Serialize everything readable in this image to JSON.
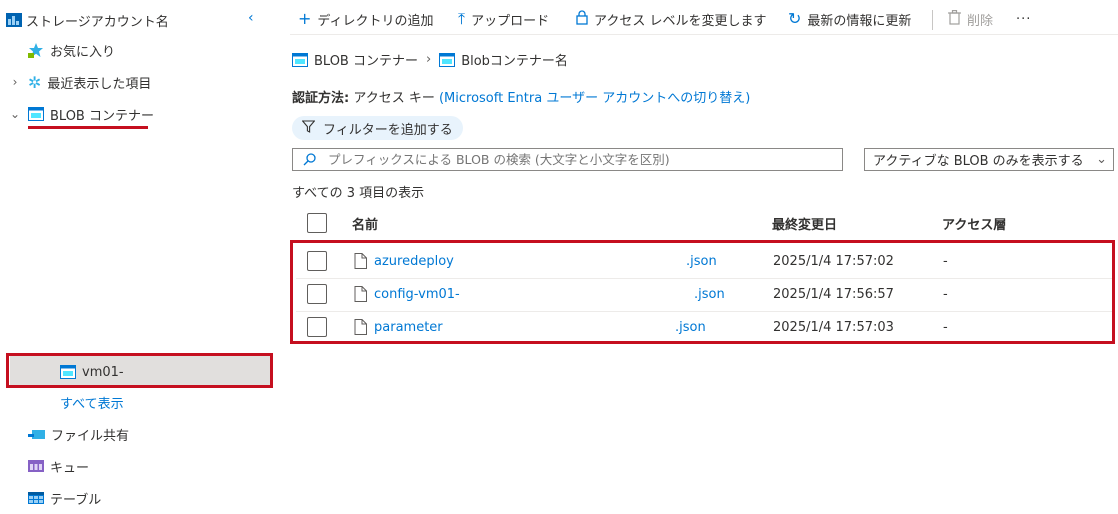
{
  "sidebar": {
    "account_name": "ストレージアカウント名",
    "favorites": "お気に入り",
    "recent": "最近表示した項目",
    "blob_containers": "BLOB コンテナー",
    "container_item": "vm01-",
    "show_all": "すべて表示",
    "file_shares": "ファイル共有",
    "queues": "キュー",
    "tables": "テーブル"
  },
  "toolbar": {
    "add_directory": "ディレクトリの追加",
    "upload": "アップロード",
    "change_access": "アクセス レベルを変更します",
    "refresh": "最新の情報に更新",
    "delete": "削除",
    "more": "···"
  },
  "breadcrumb": {
    "root": "BLOB コンテナー",
    "current": "Blobコンテナー名"
  },
  "auth": {
    "label": "認証方法:",
    "value": "アクセス キー",
    "switch_link": "(Microsoft Entra ユーザー アカウントへの切り替え)"
  },
  "filter": {
    "add_label": "フィルターを追加する"
  },
  "search": {
    "placeholder": "プレフィックスによる BLOB の検索 (大文字と小文字を区別)"
  },
  "dropdown": {
    "selected": "アクティブな BLOB のみを表示する"
  },
  "summary": "すべての 3 項目の表示",
  "table": {
    "headers": {
      "name": "名前",
      "modified": "最終変更日",
      "tier": "アクセス層"
    },
    "rows": [
      {
        "name": "azuredeploy",
        "ext": ".json",
        "modified": "2025/1/4 17:57:02",
        "tier": "-"
      },
      {
        "name": "config-vm01-",
        "ext": ".json",
        "modified": "2025/1/4 17:56:57",
        "tier": "-"
      },
      {
        "name": "parameter",
        "ext": ".json",
        "modified": "2025/1/4 17:57:03",
        "tier": "-"
      }
    ]
  },
  "colors": {
    "accent": "#0078d4",
    "highlight_red": "#c50f1f"
  }
}
